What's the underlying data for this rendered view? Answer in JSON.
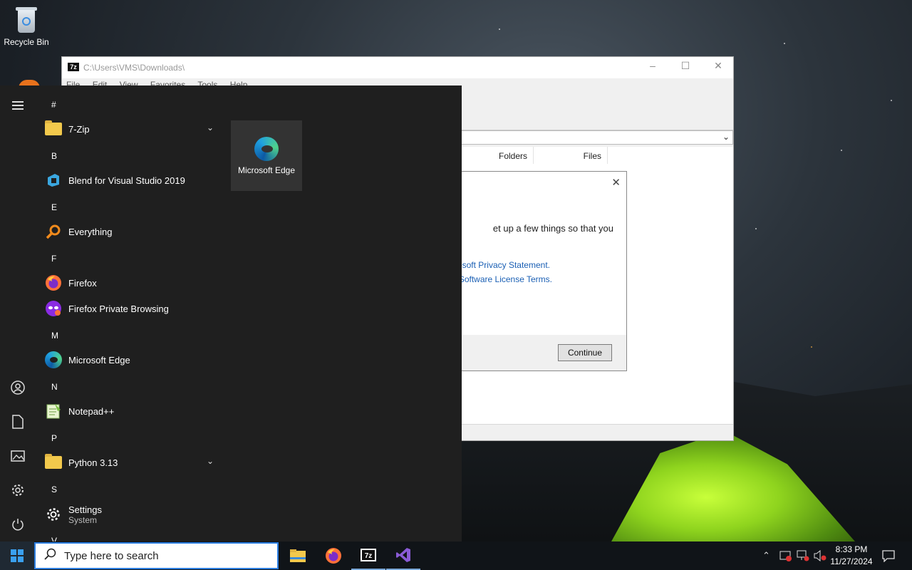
{
  "desktop": {
    "recycle_bin_label": "Recycle Bin"
  },
  "sevenzip": {
    "title_path": "C:\\Users\\VMS\\Downloads\\",
    "menu": [
      "File",
      "Edit",
      "View",
      "Favorites",
      "Tools",
      "Help"
    ],
    "columns": [
      "Folders",
      "Files"
    ]
  },
  "dialog": {
    "message_fragment": "et up a few things so that you",
    "privacy_link": "osoft Privacy Statement.",
    "license_link": "Software License Terms.",
    "continue_label": "Continue",
    "close_glyph": "✕"
  },
  "start_menu": {
    "sections": {
      "hash": "#",
      "b": "B",
      "e": "E",
      "f": "F",
      "m": "M",
      "n": "N",
      "p": "P",
      "s": "S",
      "v": "V"
    },
    "apps": {
      "seven_zip": "7-Zip",
      "blend": "Blend for Visual Studio 2019",
      "everything": "Everything",
      "firefox": "Firefox",
      "firefox_private": "Firefox Private Browsing",
      "edge": "Microsoft Edge",
      "notepadpp": "Notepad++",
      "python": "Python 3.13",
      "settings": "Settings",
      "settings_sub": "System"
    },
    "tile_edge_label": "Microsoft Edge"
  },
  "taskbar": {
    "search_placeholder": "Type here to search",
    "time": "8:33 PM",
    "date": "11/27/2024"
  },
  "colors": {
    "accent": "#2b7de0",
    "start_bg": "#1f1f1f",
    "taskbar_bg": "#101418"
  }
}
